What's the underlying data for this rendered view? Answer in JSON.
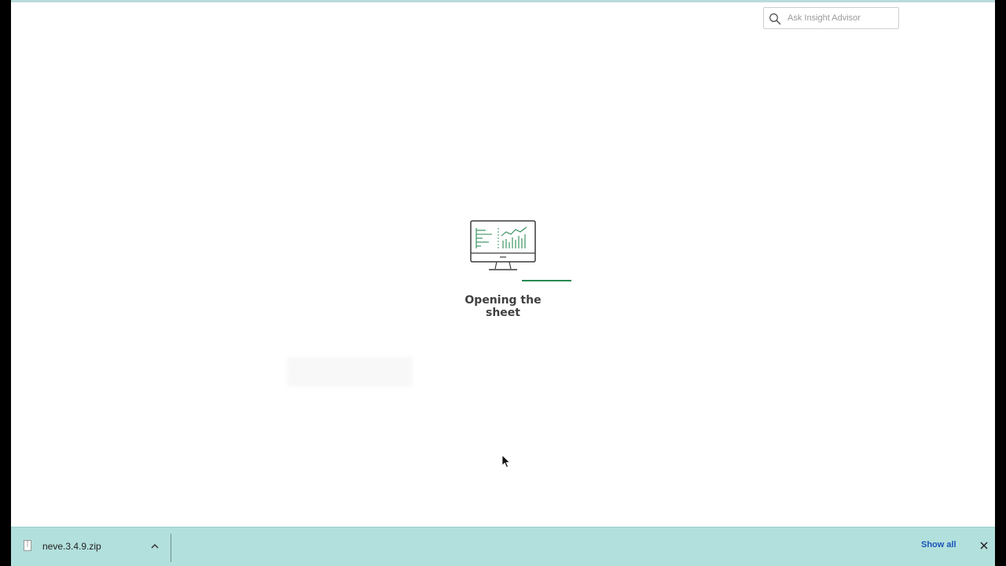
{
  "search": {
    "placeholder": "Ask Insight Advisor",
    "value": ""
  },
  "loader": {
    "message": "Opening the sheet",
    "progress": 0.5,
    "accent_color": "#2a8a54"
  },
  "download_bar": {
    "file_name": "neve.3.4.9.zip",
    "show_all_label": "Show all",
    "icons": {
      "file": "zip-file-icon",
      "expand": "chevron-up-icon",
      "close": "close-icon"
    }
  },
  "colors": {
    "download_bar_bg": "#b2e0dc",
    "show_all_link": "#1a55b8",
    "top_border": "#b9dbd9"
  }
}
